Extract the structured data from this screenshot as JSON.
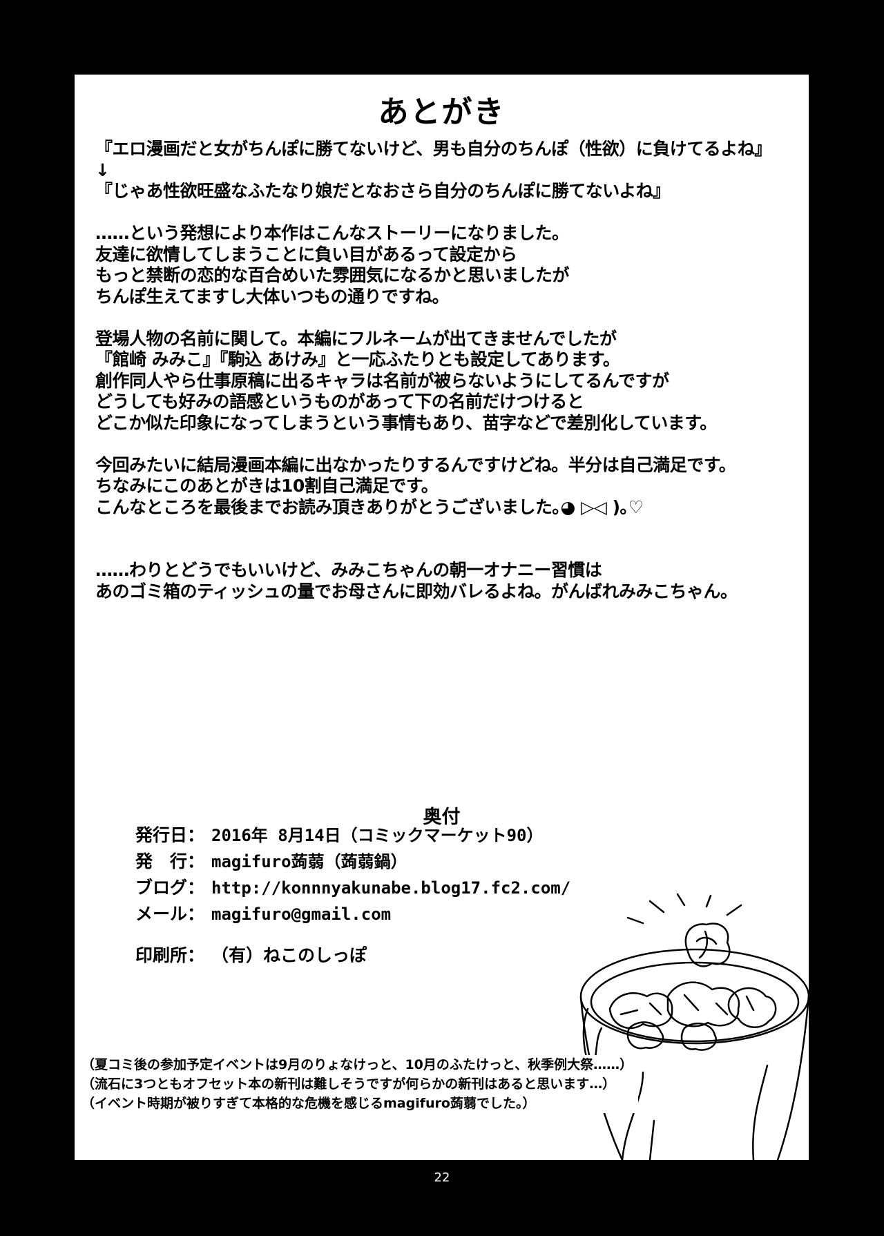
{
  "afterword": {
    "title": "あとがき",
    "lines": [
      "『エロ漫画だと女がちんぽに勝てないけど、男も自分のちんぽ（性欲）に負けてるよね』",
      "↓",
      "『じゃあ性欲旺盛なふたなり娘だとなおさら自分のちんぽに勝てないよね』",
      "",
      "……という発想により本作はこんなストーリーになりました。",
      "友達に欲情してしまうことに負い目があるって設定から",
      "もっと禁断の恋的な百合めいた雰囲気になるかと思いましたが",
      "ちんぽ生えてますし大体いつもの通りですね。",
      "",
      "登場人物の名前に関して。本編にフルネームが出てきませんでしたが",
      "『館崎 みみこ』『駒込 あけみ』と一応ふたりとも設定してあります。",
      "創作同人やら仕事原稿に出るキャラは名前が被らないようにしてるんですが",
      "どうしても好みの語感というものがあって下の名前だけつけると",
      "どこか似た印象になってしまうという事情もあり、苗字などで差別化しています。",
      "",
      "今回みたいに結局漫画本編に出なかったりするんですけどね。半分は自己満足です。",
      "ちなみにこのあとがきは10割自己満足です。",
      "こんなところを最後までお読み頂きありがとうございました｡◕ ▷◁ )｡♡",
      "",
      "",
      "……わりとどうでもいいけど、みみこちゃんの朝一オナニー習慣は",
      "あのゴミ箱のティッシュの量でお母さんに即効バレるよね。がんばれみみこちゃん。"
    ]
  },
  "colophon": {
    "title": "奥付",
    "rows": [
      {
        "label": "発行日：",
        "value": "2016年 8月14日（コミックマーケット90）"
      },
      {
        "label": "発　行：",
        "value": "magifuro蒟蒻（蒟蒻鍋）"
      },
      {
        "label": "ブログ：",
        "value": "http://konnnyakunabe.blog17.fc2.com/"
      },
      {
        "label": "メール：",
        "value": "magifuro@gmail.com"
      },
      {
        "label": "印刷所：",
        "value": "（有）ねこのしっぽ"
      }
    ]
  },
  "notes": [
    "（夏コミ後の参加予定イベントは9月のりょなけっと、10月のふたけっと、秋季例大祭……）",
    "（流石に3つともオフセット本の新刊は難しそうですが何らかの新刊はあると思います…）",
    "（イベント時期が被りすぎて本格的な危機を感じるmagifuro蒟蒻でした。）"
  ],
  "page_number": "22"
}
